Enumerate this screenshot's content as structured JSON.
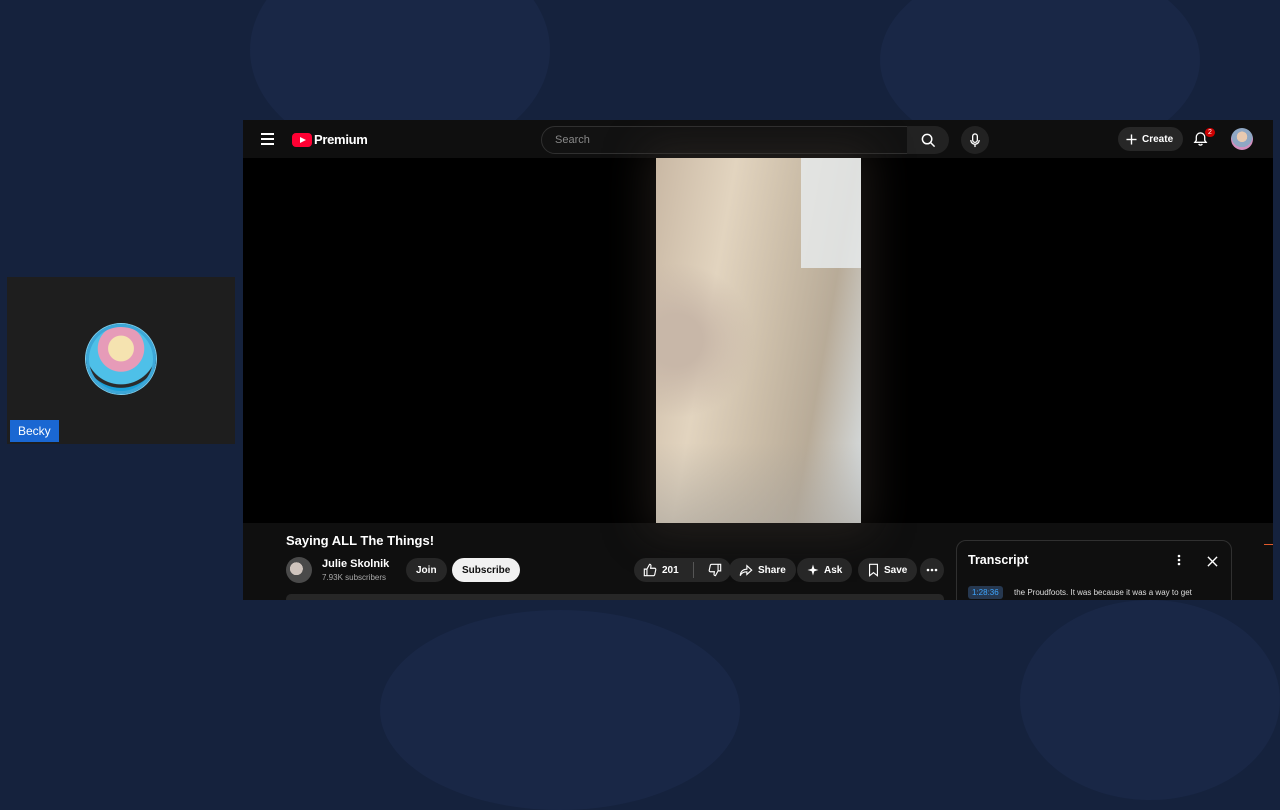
{
  "participant": {
    "name": "Becky"
  },
  "youtube": {
    "brand": "Premium",
    "search_placeholder": "Search",
    "create_label": "Create",
    "notification_count": "2",
    "video": {
      "title": "Saying ALL The Things!",
      "channel_name": "Julie Skolnik",
      "subscribers": "7.93K subscribers",
      "join_label": "Join",
      "subscribe_label": "Subscribe",
      "likes": "201",
      "share_label": "Share",
      "ask_label": "Ask",
      "save_label": "Save"
    },
    "transcript": {
      "title": "Transcript",
      "timestamp": "1:28:36",
      "text": "the Proudfoots. It was because it was a way to get"
    }
  },
  "colors": {
    "brand_red": "#ff0033",
    "background": "#15223d",
    "link_blue": "#3ea6ff"
  }
}
